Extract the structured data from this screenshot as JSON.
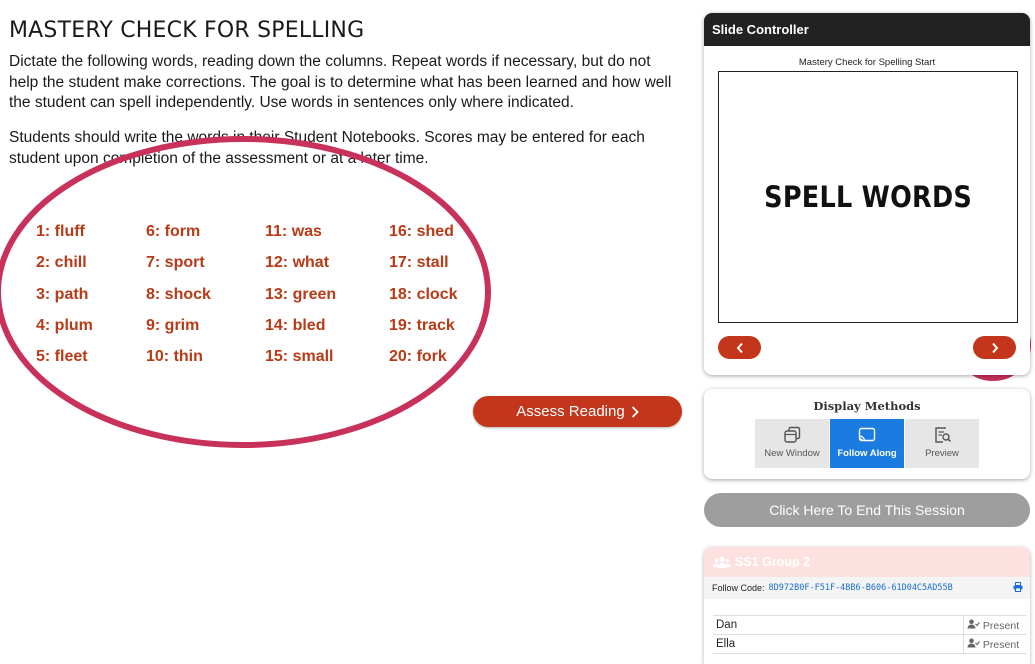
{
  "page": {
    "title": "MASTERY CHECK FOR SPELLING",
    "paragraph1": "Dictate the following words, reading down the columns. Repeat words if necessary, but do not help the student make corrections. The goal is to determine what has been learned and how well the student can spell independently. Use words in sentences only where indicated.",
    "paragraph2": "Students should write the words in their Student Notebooks. Scores may be entered for each student upon completion of the assessment or at a later time.",
    "words": [
      "1: fluff",
      "2: chill",
      "3: path",
      "4: plum",
      "5: fleet",
      "6: form",
      "7: sport",
      "8: shock",
      "9: grim",
      "10: thin",
      "11: was",
      "12: what",
      "13: green",
      "14: bled",
      "15: small",
      "16: shed",
      "17: stall",
      "18: clock",
      "19: track",
      "20: fork"
    ],
    "assess_button": "Assess Reading",
    "assess_icon": "chevron-right-icon"
  },
  "slide_controller": {
    "header": "Slide Controller",
    "caption": "Mastery Check for Spelling Start",
    "slide_text": "SPELL WORDS",
    "prev_icon": "chevron-left-icon",
    "next_icon": "chevron-right-icon"
  },
  "display_methods": {
    "title": "Display Methods",
    "options": [
      {
        "label": "New Window",
        "icon": "new-window-icon",
        "selected": false
      },
      {
        "label": "Follow Along",
        "icon": "cast-icon",
        "selected": true
      },
      {
        "label": "Preview",
        "icon": "preview-icon",
        "selected": false
      }
    ]
  },
  "end_session_label": "Click Here To End This Session",
  "group": {
    "name": "SS1 Group 2",
    "icon": "users-icon",
    "follow_code_label": "Follow Code:",
    "follow_code": "8D972B0F-F51F-4BB6-B606-61D04C5AD55B",
    "students": [
      {
        "name": "Dan",
        "status": "Present"
      },
      {
        "name": "Ella",
        "status": "Present"
      }
    ]
  },
  "colors": {
    "accent_red": "#c4361c",
    "word_red": "#b83a16",
    "annotation_magenta": "#c8315a",
    "selected_blue": "#1a7be0",
    "end_session_gray": "#9e9e9e"
  }
}
